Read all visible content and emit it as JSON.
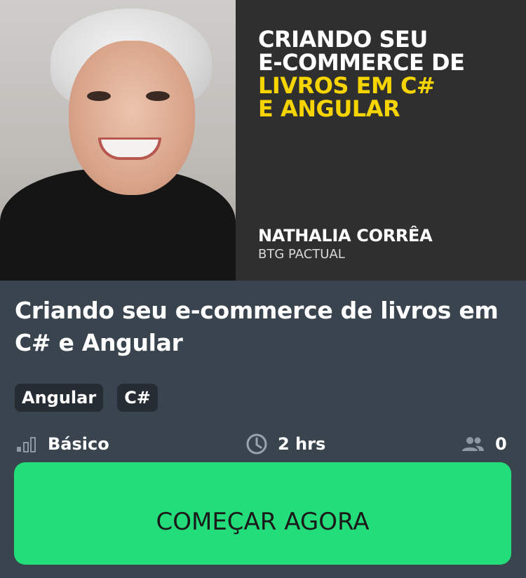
{
  "banner": {
    "headline_white": [
      "CRIANDO SEU",
      "E-COMMERCE DE"
    ],
    "headline_yellow": [
      "LIVROS EM C#",
      "E ANGULAR"
    ],
    "author": "NATHALIA CORRÊA",
    "company": "BTG PACTUAL",
    "colors": {
      "background": "#2f2f30",
      "headline_white": "#ffffff",
      "headline_yellow": "#f5d400"
    }
  },
  "course": {
    "title": "Criando seu e-commerce de livros em C# e Angular"
  },
  "tags": [
    "Angular",
    "C#"
  ],
  "meta": {
    "level": {
      "icon": "signal-bars-icon",
      "label": "Básico"
    },
    "duration": {
      "icon": "clock-icon",
      "label": "2 hrs"
    },
    "students": {
      "icon": "people-icon",
      "label": "0"
    }
  },
  "cta": {
    "label": "COMEÇAR AGORA",
    "color": "#22dd7a"
  },
  "theme": {
    "card_background": "#3a444f",
    "tag_background": "#262c34"
  }
}
